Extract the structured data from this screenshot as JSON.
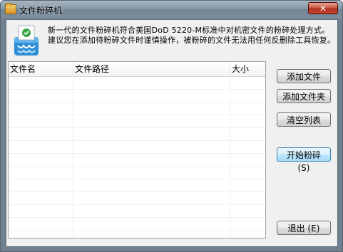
{
  "window": {
    "title": "文件粉碎机",
    "close_label": "✕"
  },
  "description": "新一代的文件粉碎机符合美国DoD 5220-M标准中对机密文件的粉碎处理方式。建议您在添加待粉碎文件时谨慎操作，被粉碎的文件无法用任何反删除工具恢复。",
  "file_list": {
    "columns": [
      "文件名",
      "文件路径",
      "大小"
    ],
    "rows": []
  },
  "buttons": {
    "add_file": "添加文件",
    "add_folder": "添加文件夹",
    "clear_list": "清空列表",
    "start_shred": "开始粉碎 (S)",
    "exit": "退出 (E)"
  },
  "icons": {
    "title": "folder-icon",
    "app": "shredder-icon",
    "close": "close-icon"
  }
}
